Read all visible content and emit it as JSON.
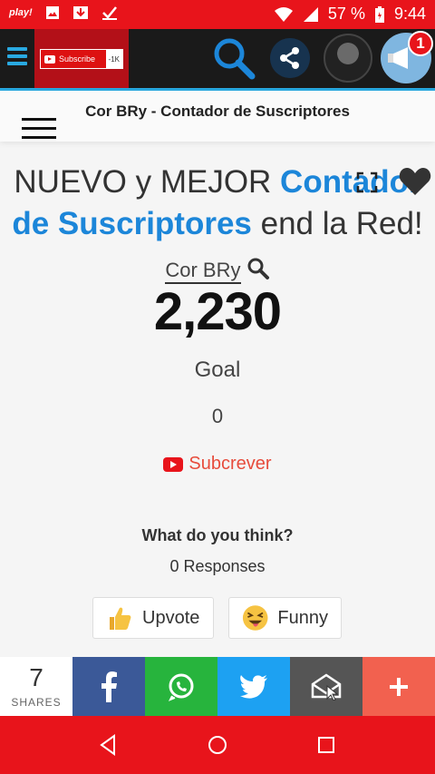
{
  "status_bar": {
    "play_label": "play!",
    "battery_percent": "57 %",
    "time": "9:44"
  },
  "app_bar": {
    "subscribe_label": "Subscribe",
    "subscribe_count": "-1K",
    "notification_count": "1"
  },
  "page_title": "Cor BRy - Contador de Suscriptores",
  "headline": {
    "part1": "NUEVO y MEJOR ",
    "highlight": "Contador de Suscriptores",
    "part2": " end la Red!"
  },
  "channel_name": "Cor BRy",
  "subscriber_count": "2,230",
  "goal_label": "Goal",
  "goal_value": "0",
  "subscribe_link": "Subcrever",
  "feedback": {
    "question": "What do you think?",
    "responses": "0 Responses",
    "upvote": "Upvote",
    "funny": "Funny"
  },
  "share_bar": {
    "count": "7",
    "label": "SHARES"
  },
  "colors": {
    "status_bar": "#e8141b",
    "accent_blue": "#1c86d9",
    "facebook": "#3b5998",
    "whatsapp": "#27b43d",
    "twitter": "#1da1f2",
    "email": "#555555",
    "more": "#f2614f"
  }
}
